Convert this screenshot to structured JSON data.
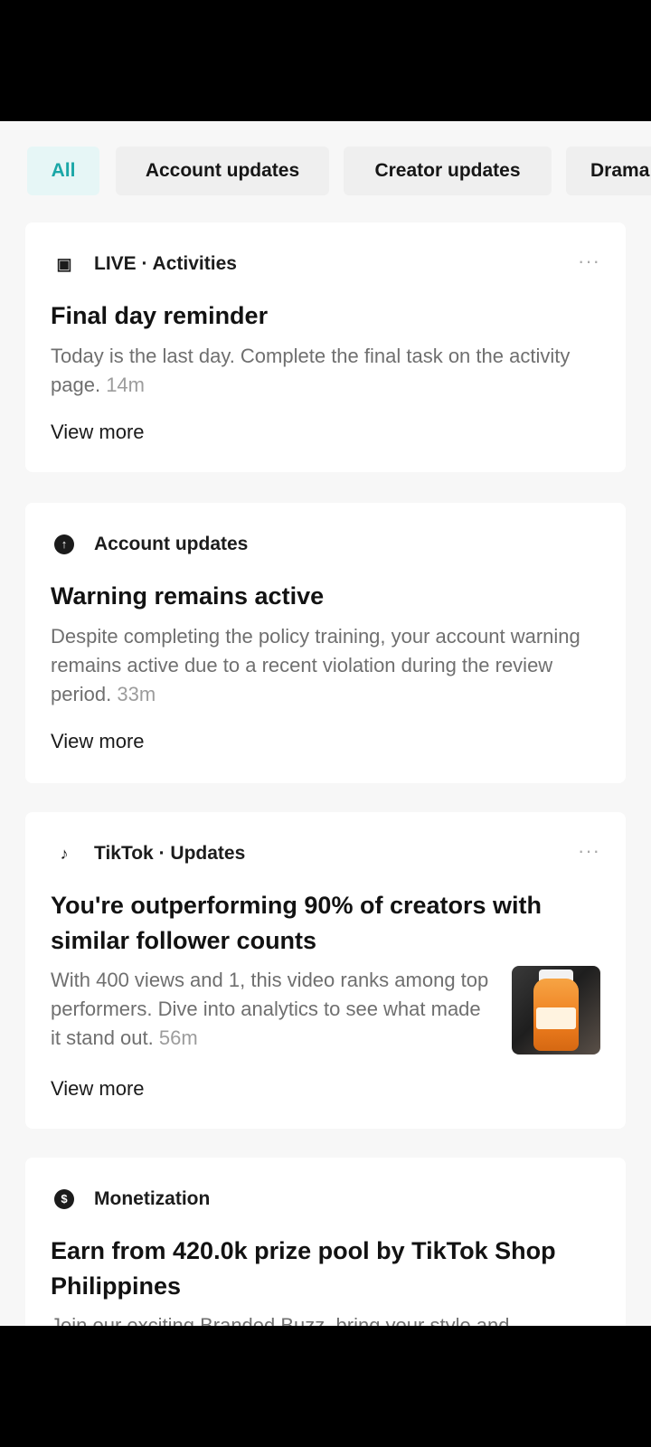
{
  "filters": [
    {
      "label": "All",
      "active": true
    },
    {
      "label": "Account updates",
      "active": false
    },
    {
      "label": "Creator updates",
      "active": false
    },
    {
      "label": "Drama",
      "active": false
    }
  ],
  "cards": [
    {
      "icon": "live-tv-icon",
      "category": "LIVE · Activities",
      "has_more_menu": true,
      "title": "Final day reminder",
      "body": "Today is the last day. Complete the final task on the activity page.",
      "time": "14m",
      "link": "View more"
    },
    {
      "icon": "arrow-up-circle-icon",
      "category": "Account updates",
      "has_more_menu": false,
      "title": "Warning remains active",
      "body": "Despite completing the policy training, your account warning remains active due to a recent violation during the review period.",
      "time": "33m",
      "link": "View more"
    },
    {
      "icon": "tiktok-logo-icon",
      "category": "TikTok · Updates",
      "has_more_menu": true,
      "title": "You're outperforming 90% of creators with similar follower counts",
      "body": "With 400 views and 1, this video ranks among top performers. Dive into analytics to see what made it stand out.",
      "time": "56m",
      "link": "View more",
      "thumbnail": "video-thumbnail-supplement-bottle"
    },
    {
      "icon": "dollar-circle-icon",
      "category": "Monetization",
      "has_more_menu": false,
      "title": "Earn from 420.0k prize pool by TikTok Shop Philippines",
      "body": "Join our exciting Branded Buzz, bring your style and"
    }
  ],
  "more_symbol": "···",
  "icons": {
    "live": "▣",
    "account": "↑",
    "tiktok": "♪",
    "money": "$"
  },
  "colors": {
    "active_chip_text": "#1aa7a7",
    "active_chip_bg": "#e6f6f6",
    "body_text": "#6f6f6f",
    "time_text": "#9c9c9c"
  }
}
